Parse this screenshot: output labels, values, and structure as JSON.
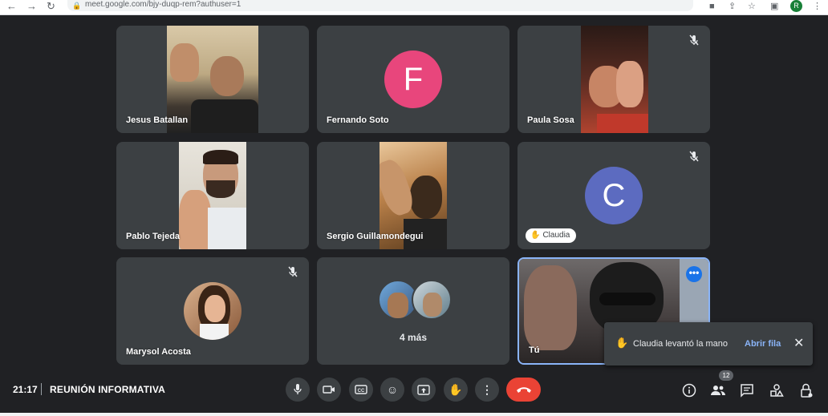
{
  "browser": {
    "url": "meet.google.com/bjy-duqp-rem?authuser=1",
    "profile_initial": "R"
  },
  "tiles": [
    {
      "name": "Jesus Batallan"
    },
    {
      "name": "Fernando Soto",
      "avatar_letter": "F",
      "avatar_color": "#e8467c"
    },
    {
      "name": "Paula Sosa"
    },
    {
      "name": "Pablo Tejeda"
    },
    {
      "name": "Sergio Guillamondegui"
    },
    {
      "name": "Claudia",
      "avatar_letter": "C",
      "avatar_color": "#5c6bc0"
    },
    {
      "name": "Marysol Acosta"
    },
    {
      "name": "4 más"
    },
    {
      "name": "Tú",
      "options_label": "•••"
    }
  ],
  "toast": {
    "message": "Claudia levantó la mano",
    "action": "Abrir fila"
  },
  "bottom_bar": {
    "time": "21:17",
    "meeting_title": "REUNIÓN INFORMATIVA",
    "participants_count": "12"
  },
  "colors": {
    "background": "#202124",
    "tile": "#3c4043",
    "accent": "#1a73e8",
    "end_call": "#ea4335",
    "link": "#8ab4f8"
  },
  "icons": [
    "mic-icon",
    "camera-icon",
    "captions-icon",
    "emoji-icon",
    "present-icon",
    "raise-hand-icon",
    "more-options-icon",
    "end-call-icon",
    "info-icon",
    "people-icon",
    "chat-icon",
    "activities-icon",
    "host-controls-icon"
  ]
}
